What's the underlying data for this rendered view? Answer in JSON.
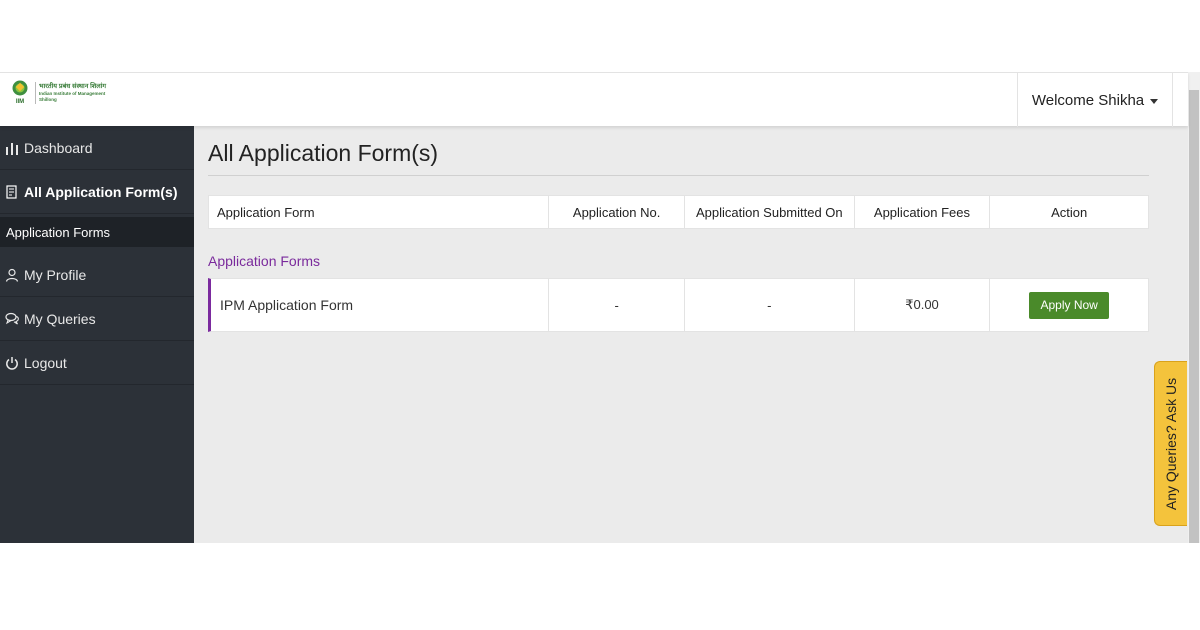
{
  "header": {
    "logo": {
      "hindi_name": "भारतीय प्रबंध संस्थान शिलांग",
      "english_name": "Indian Institute of Management",
      "city": "Shillong",
      "emblem_text": "IIM"
    },
    "welcome_text": "Welcome Shikha"
  },
  "sidebar": {
    "items": [
      {
        "label": "Dashboard",
        "icon": "bar-chart-icon"
      },
      {
        "label": "All Application Form(s)",
        "icon": "document-icon",
        "active": true
      },
      {
        "label": "My Profile",
        "icon": "user-icon"
      },
      {
        "label": "My Queries",
        "icon": "chat-icon"
      },
      {
        "label": "Logout",
        "icon": "power-icon"
      }
    ],
    "sub_item": "Application Forms"
  },
  "main": {
    "title": "All Application Form(s)",
    "table": {
      "headers": [
        "Application Form",
        "Application No.",
        "Application Submitted On",
        "Application Fees",
        "Action"
      ],
      "section_label": "Application Forms",
      "rows": [
        {
          "form": "IPM Application Form",
          "app_no": "-",
          "submitted_on": "-",
          "fees": "₹0.00",
          "action": "Apply Now"
        }
      ]
    }
  },
  "queries_tab": "Any Queries? Ask Us",
  "colors": {
    "sidebar_bg": "#2c3138",
    "accent_purple": "#7b2a9e",
    "button_green": "#4a8a2a",
    "query_tab_yellow": "#f4c33c"
  }
}
